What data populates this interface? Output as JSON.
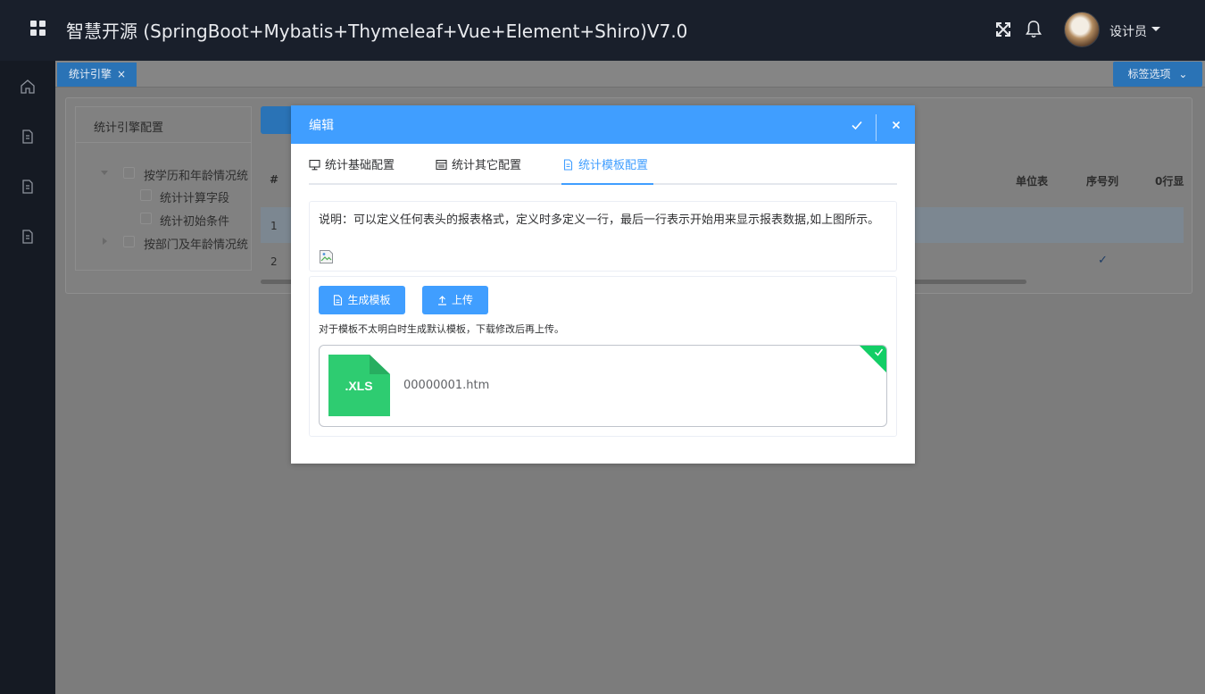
{
  "header": {
    "title": "智慧开源 (SpringBoot+Mybatis+Thymeleaf+Vue+Element+Shiro)V7.0",
    "user_name": "设计员"
  },
  "tabbar": {
    "active_tab": "统计引擎",
    "close_glyph": "×",
    "options_label": "标签选项"
  },
  "tree": {
    "title": "统计引擎配置",
    "nodes": [
      {
        "label": "按学历和年龄情况统"
      },
      {
        "label": "统计计算字段"
      },
      {
        "label": "统计初始条件"
      },
      {
        "label": "按部门及年龄情况统"
      }
    ]
  },
  "grid": {
    "columns": [
      "#",
      "单位表",
      "序号列",
      "0行显"
    ],
    "rows": [
      "1",
      "2"
    ],
    "check_glyph": "✓"
  },
  "dialog": {
    "title": "编辑",
    "tabs": [
      {
        "label": "统计基础配置",
        "icon": "monitor-icon"
      },
      {
        "label": "统计其它配置",
        "icon": "calendar-icon"
      },
      {
        "label": "统计模板配置",
        "icon": "document-icon"
      }
    ],
    "description": "说明：可以定义任何表头的报表格式，定义时多定义一行，最后一行表示开始用来显示报表数据,如上图所示。",
    "generate_button": "生成模板",
    "upload_button": "上传",
    "hint": "对于模板不太明白时生成默认模板，下载修改后再上传。",
    "file": {
      "badge": ".XLS",
      "name": "00000001.htm"
    }
  },
  "colors": {
    "topbar": "#191f2b",
    "accent": "#409eff",
    "success": "#13ce66",
    "file_icon": "#2ecc71"
  }
}
